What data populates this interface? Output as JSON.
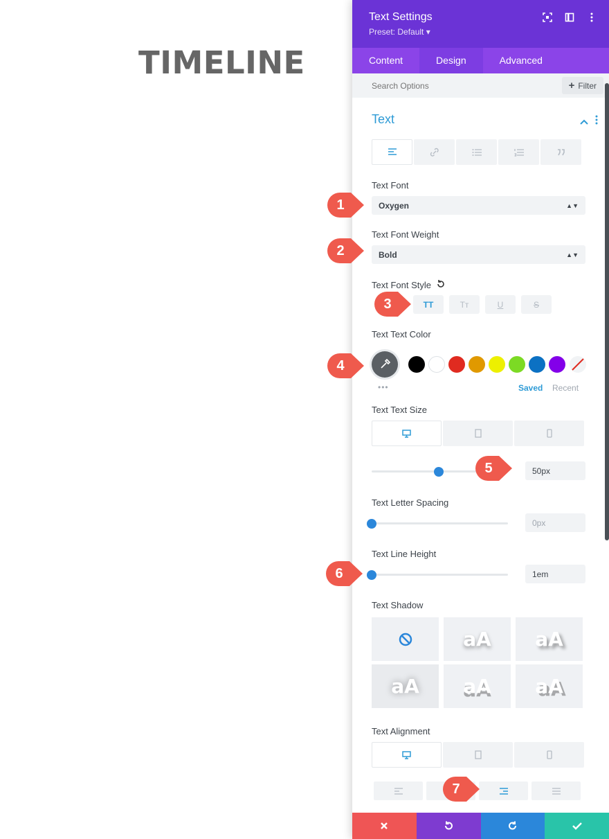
{
  "page": {
    "heading": "TIMELINE"
  },
  "panel": {
    "title": "Text Settings",
    "preset": "Preset: Default ▾",
    "tabs": [
      "Content",
      "Design",
      "Advanced"
    ],
    "search_placeholder": "Search Options",
    "filter_label": "Filter",
    "section_title": "Text",
    "text_font": {
      "label": "Text Font",
      "value": "Oxygen"
    },
    "text_font_weight": {
      "label": "Text Font Weight",
      "value": "Bold"
    },
    "text_font_style": {
      "label": "Text Font Style",
      "buttons": [
        "TT",
        "Tт",
        "U",
        "S"
      ]
    },
    "text_color": {
      "label": "Text Text Color",
      "swatches": [
        "#000000",
        "#ffffff",
        "#e02b20",
        "#e09900",
        "#edf000",
        "#7cda24",
        "#0c71c3",
        "#8300e9"
      ],
      "saved": "Saved",
      "recent": "Recent"
    },
    "text_size": {
      "label": "Text Text Size",
      "value": "50px",
      "slider_fraction": 0.49
    },
    "letter_spacing": {
      "label": "Text Letter Spacing",
      "value": "0px",
      "slider_fraction": 0.0
    },
    "line_height": {
      "label": "Text Line Height",
      "value": "1em",
      "slider_fraction": 0.0
    },
    "text_shadow": {
      "label": "Text Shadow",
      "option_text": "aA"
    },
    "text_alignment": {
      "label": "Text Alignment"
    },
    "footer_colors": [
      "#ef5555",
      "#7e3bd0",
      "#2b87da",
      "#29c4a9"
    ]
  },
  "markers": [
    "1",
    "2",
    "3",
    "4",
    "5",
    "6",
    "7"
  ]
}
